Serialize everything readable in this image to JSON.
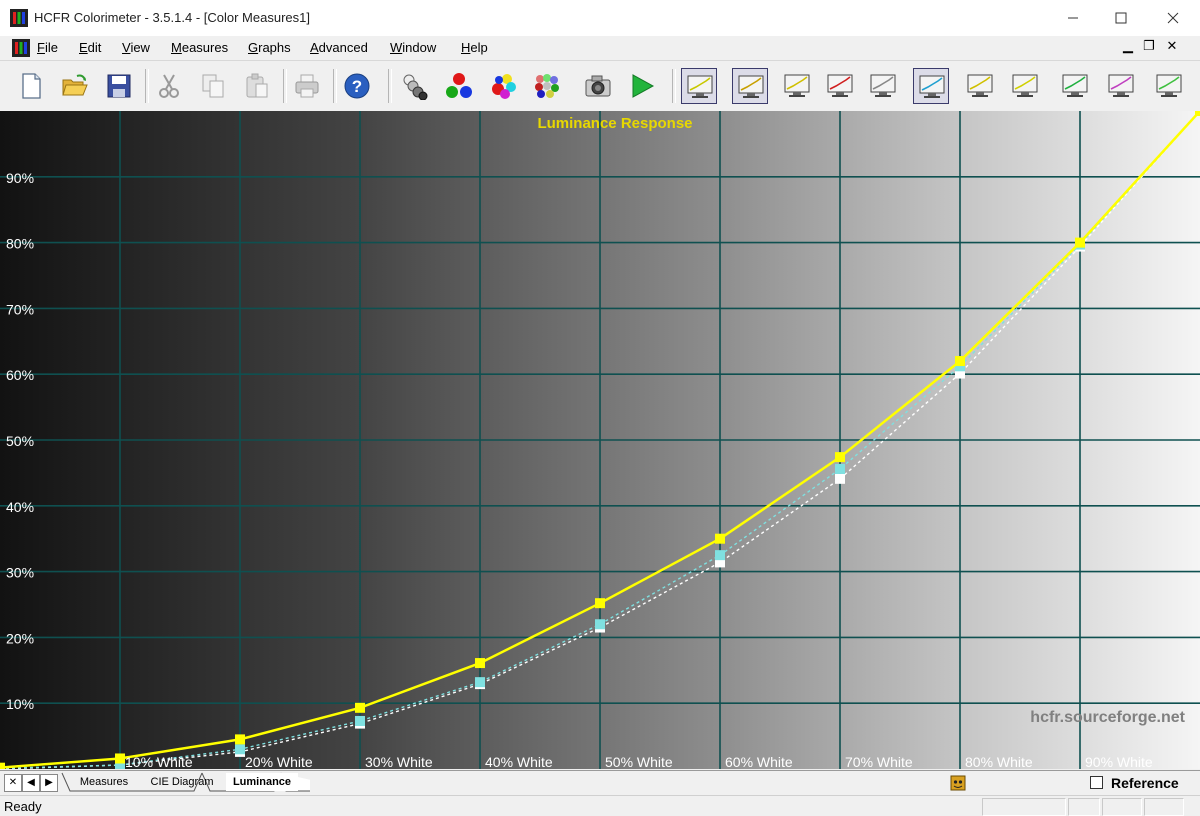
{
  "window": {
    "title": "HCFR Colorimeter - 3.5.1.4 - [Color Measures1]"
  },
  "menu": [
    "File",
    "Edit",
    "View",
    "Measures",
    "Graphs",
    "Advanced",
    "Window",
    "Help"
  ],
  "toolbar": {
    "buttons": [
      {
        "name": "new-document-icon",
        "pressed": false
      },
      {
        "name": "open-folder-icon",
        "pressed": false
      },
      {
        "name": "save-icon",
        "pressed": false
      },
      {
        "name": "cut-icon",
        "pressed": false
      },
      {
        "name": "copy-icon",
        "pressed": false
      },
      {
        "name": "paste-icon",
        "pressed": false
      },
      {
        "name": "print-icon",
        "pressed": false
      },
      {
        "name": "help-icon",
        "pressed": false
      },
      {
        "name": "grayscale-measure-icon",
        "pressed": false
      },
      {
        "name": "primaries-measure-icon",
        "pressed": false
      },
      {
        "name": "secondaries-measure-icon",
        "pressed": false
      },
      {
        "name": "saturation-measure-icon",
        "pressed": false
      },
      {
        "name": "camera-icon",
        "pressed": false
      },
      {
        "name": "play-icon",
        "pressed": false
      },
      {
        "name": "luminance-graph-icon",
        "pressed": true
      },
      {
        "name": "gamma-graph-icon",
        "pressed": true
      },
      {
        "name": "color-temperature-graph-icon",
        "pressed": false
      },
      {
        "name": "rgb-levels-graph-icon",
        "pressed": false
      },
      {
        "name": "delta-e-graph-icon",
        "pressed": false
      },
      {
        "name": "cie-diagram-icon",
        "pressed": true
      },
      {
        "name": "near-black-graph-icon",
        "pressed": false
      },
      {
        "name": "near-white-graph-icon",
        "pressed": false
      },
      {
        "name": "saturation-shift-graph-icon",
        "pressed": false
      },
      {
        "name": "saturation-luminance-graph-icon",
        "pressed": false
      },
      {
        "name": "color-checker-graph-icon",
        "pressed": false
      }
    ]
  },
  "chart_data": {
    "type": "line",
    "title": "Luminance Response",
    "watermark": "hcfr.sourceforge.net",
    "x": [
      0,
      10,
      20,
      30,
      40,
      50,
      60,
      70,
      80,
      90,
      100
    ],
    "x_tick_labels": [
      "10% White",
      "20% White",
      "30% White",
      "40% White",
      "50% White",
      "60% White",
      "70% White",
      "80% White",
      "90% White"
    ],
    "y_tick_labels": [
      "10%",
      "20%",
      "30%",
      "40%",
      "50%",
      "60%",
      "70%",
      "80%",
      "90%"
    ],
    "xlim": [
      0,
      100
    ],
    "ylim": [
      0,
      100
    ],
    "grid": true,
    "series": [
      {
        "role": "measured",
        "color": "#ffff00",
        "line": "solid",
        "values": [
          0.2,
          1.6,
          4.5,
          9.3,
          16.1,
          25.2,
          35.0,
          47.4,
          62.0,
          80.0,
          100.0
        ]
      },
      {
        "role": "measured-alt",
        "color": "#7fe0e0",
        "line": "dotted",
        "values": [
          0.1,
          0.6,
          3.0,
          7.3,
          13.2,
          22.0,
          32.5,
          45.6,
          61.2,
          79.7,
          100.0
        ]
      },
      {
        "role": "reference",
        "color": "#ffffff",
        "line": "dotted",
        "values": [
          0.0,
          0.6,
          2.6,
          6.9,
          12.9,
          21.5,
          31.4,
          44.1,
          60.1,
          79.4,
          100.0
        ]
      }
    ],
    "colors": {
      "grid": "#0f5050",
      "title": "#e8d800",
      "labels": "#ffffff",
      "watermark": "#808080"
    }
  },
  "tabs": {
    "nav": [
      "✕",
      "◀",
      "▶"
    ],
    "items": [
      {
        "label": "Measures",
        "active": false
      },
      {
        "label": "CIE Diagram",
        "active": false
      },
      {
        "label": "Luminance",
        "active": true
      }
    ],
    "reference_label": "Reference",
    "reference_checked": false
  },
  "status": {
    "text": "Ready"
  }
}
